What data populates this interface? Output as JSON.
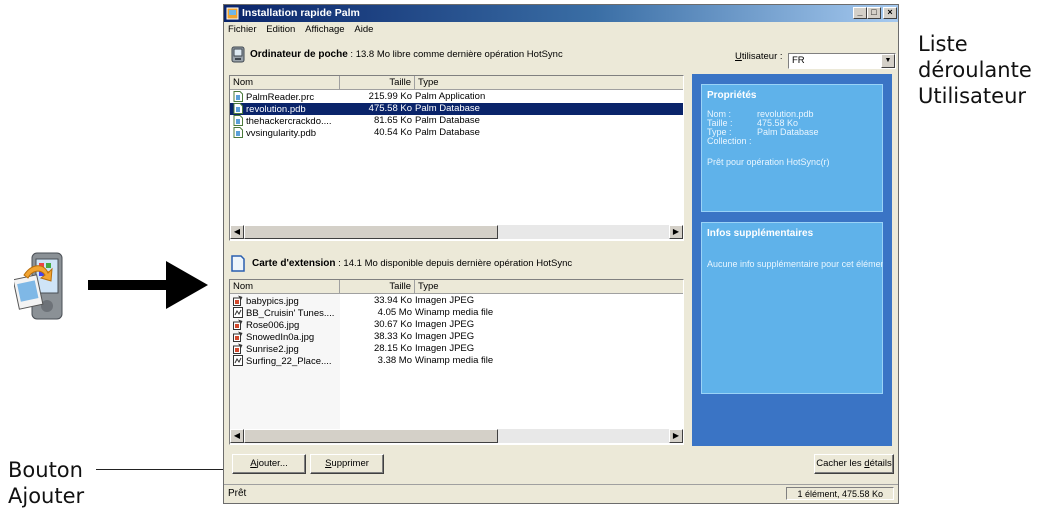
{
  "callouts": {
    "user_dropdown": [
      "Liste",
      "déroulante",
      "Utilisateur"
    ],
    "add_button": [
      "Bouton",
      "Ajouter"
    ]
  },
  "window": {
    "title": "Installation rapide Palm",
    "controls": {
      "minimize": "_",
      "maximize": "□",
      "close": "×"
    }
  },
  "menu": [
    "Fichier",
    "Edition",
    "Affichage",
    "Aide"
  ],
  "handheld": {
    "heading": "Ordinateur de poche",
    "info": " : 13.8 Mo libre comme dernière opération HotSync",
    "user_label": "tilisateur :",
    "user_label_mnemonic": "U",
    "user_value": "FR",
    "columns": [
      "Nom",
      "Taille",
      "Type"
    ],
    "files": [
      {
        "name": "PalmReader.prc",
        "size": "215.99 Ko",
        "type": "Palm Application",
        "selected": false
      },
      {
        "name": "revolution.pdb",
        "size": "475.58 Ko",
        "type": "Palm Database",
        "selected": true
      },
      {
        "name": "thehackercrackdo....",
        "size": "81.65 Ko",
        "type": "Palm Database",
        "selected": false
      },
      {
        "name": "vvsingularity.pdb",
        "size": "40.54 Ko",
        "type": "Palm Database",
        "selected": false
      }
    ]
  },
  "card": {
    "heading": "Carte d'extension",
    "info": " : 14.1 Mo disponible depuis dernière opération HotSync",
    "columns": [
      "Nom",
      "Taille",
      "Type"
    ],
    "files": [
      {
        "name": "babypics.jpg",
        "size": "33.94 Ko",
        "type": "Imagen JPEG",
        "icon": "image"
      },
      {
        "name": "BB_Cruisin' Tunes....",
        "size": "4.05 Mo",
        "type": "Winamp media file",
        "icon": "media"
      },
      {
        "name": "Rose006.jpg",
        "size": "30.67 Ko",
        "type": "Imagen JPEG",
        "icon": "image"
      },
      {
        "name": "SnowedIn0a.jpg",
        "size": "38.33 Ko",
        "type": "Imagen JPEG",
        "icon": "image"
      },
      {
        "name": "Sunrise2.jpg",
        "size": "28.15 Ko",
        "type": "Imagen JPEG",
        "icon": "image"
      },
      {
        "name": "Surfing_22_Place....",
        "size": "3.38 Mo",
        "type": "Winamp media file",
        "icon": "media"
      }
    ]
  },
  "properties": {
    "title": "Propriétés",
    "rows": [
      {
        "key": "Nom :",
        "value": "revolution.pdb"
      },
      {
        "key": "Taille :",
        "value": "475.58 Ko"
      },
      {
        "key": "Type :",
        "value": "Palm Database"
      },
      {
        "key": "Collection :",
        "value": ""
      }
    ],
    "status": "Prêt pour opération HotSync(r)"
  },
  "extra_info": {
    "title": "Infos supplémentaires",
    "text": "Aucune info supplémentaire pour cet élémen"
  },
  "buttons": {
    "add": {
      "mnemonic": "A",
      "rest": "jouter..."
    },
    "delete": {
      "mnemonic": "S",
      "rest": "upprimer"
    },
    "hide_details": {
      "before": "Cacher les ",
      "mnemonic": "d",
      "after": "étails"
    }
  },
  "status": {
    "left": "Prêt",
    "right": "1 élément, 475.58 Ko"
  },
  "colors": {
    "titlebar": "#0a246a",
    "selection": "#0a246a",
    "panel": "#3a74c5",
    "card": "#5fb2ea"
  }
}
